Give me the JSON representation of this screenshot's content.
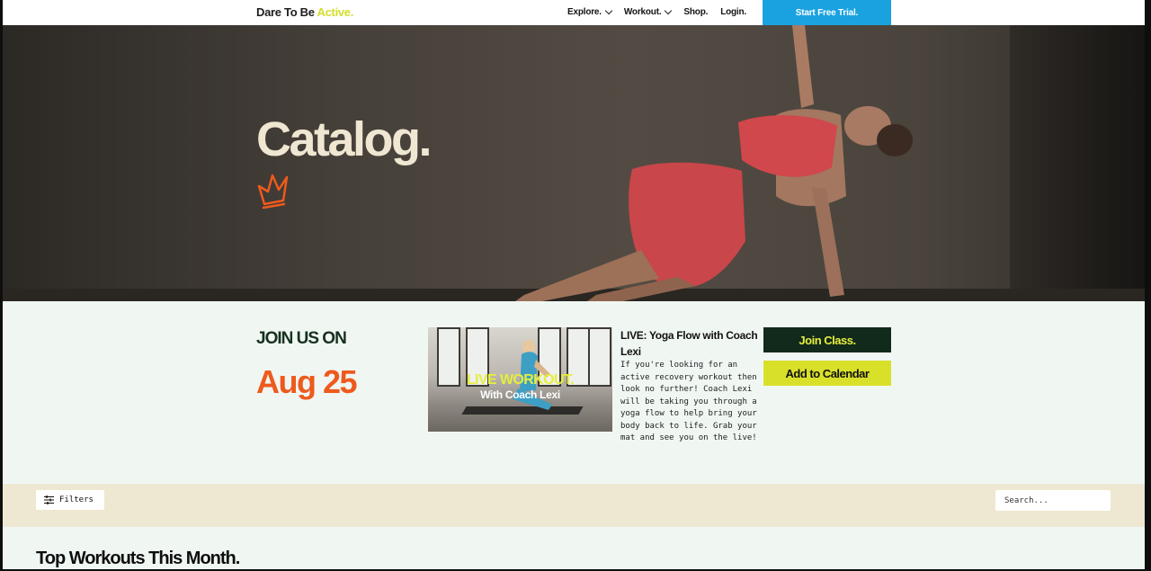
{
  "nav": {
    "logo_main": "Dare To Be",
    "logo_accent": "Active.",
    "links": [
      {
        "label": "Explore.",
        "dropdown": true
      },
      {
        "label": "Workout.",
        "dropdown": true
      },
      {
        "label": "Shop.",
        "dropdown": false
      },
      {
        "label": "Login.",
        "dropdown": false
      }
    ],
    "cta_label": "Start Free Trial."
  },
  "hero": {
    "title": "Catalog.",
    "icon": "crown-icon"
  },
  "event": {
    "heading": "JOIN US ON",
    "date": "Aug 25",
    "thumbnail_line1": "LIVE WORKOUT.",
    "thumbnail_line2": "With Coach Lexi",
    "title": "LIVE: Yoga Flow with Coach Lexi",
    "description": "If you're looking for an active recovery workout then look no further! Coach Lexi will be taking you through a yoga flow to help bring your body back to life. Grab your mat and see you on the live!",
    "join_label": "Join Class.",
    "calendar_label": "Add to Calendar"
  },
  "filters": {
    "button_label": "Filters",
    "search_placeholder": "Search..."
  },
  "sections": {
    "top_workouts_title": "Top Workouts This Month."
  },
  "colors": {
    "accent_yellow": "#d9e02a",
    "accent_orange": "#ee5a1d",
    "cta_blue": "#1aa2e0",
    "dark_green": "#122a1c",
    "bg_mint": "#f0f7f3",
    "bg_sand": "#eee8d2"
  }
}
